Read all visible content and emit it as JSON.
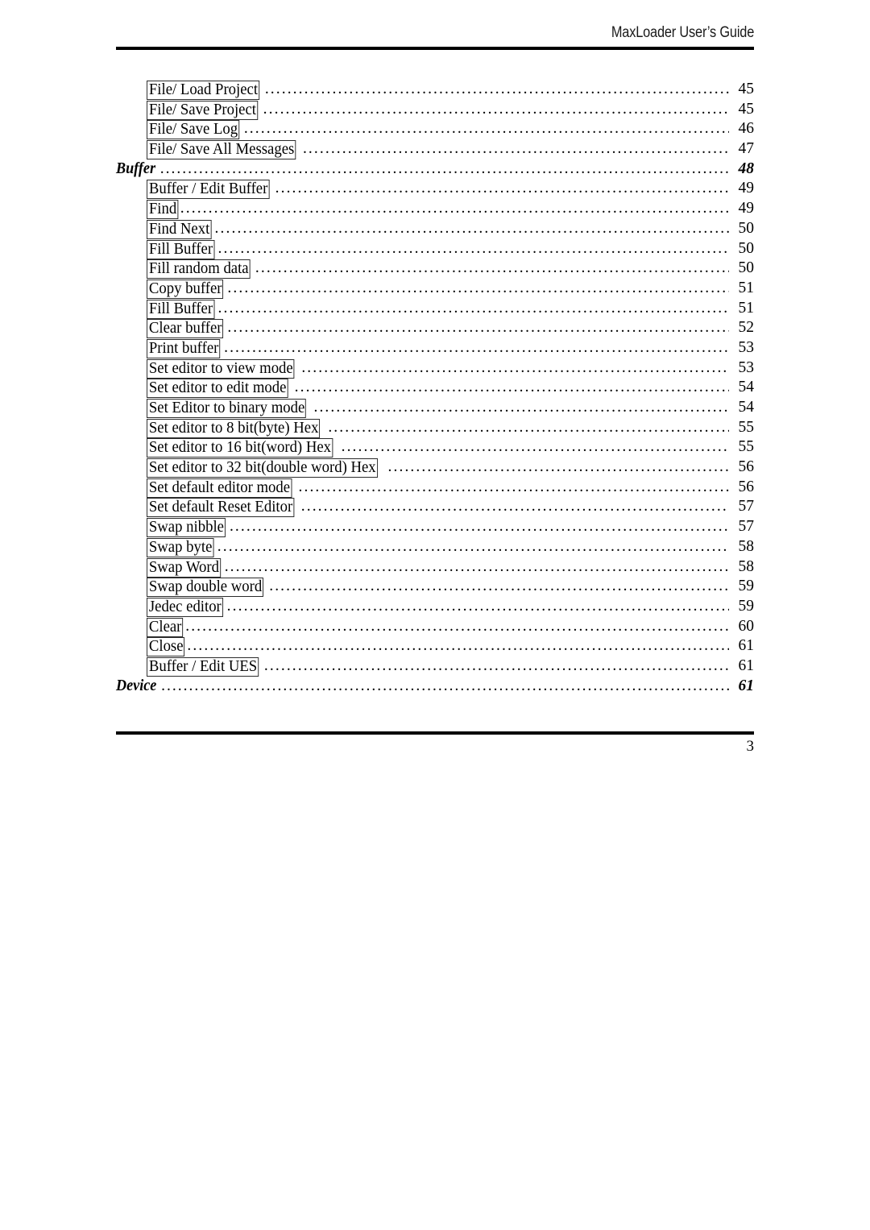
{
  "header": {
    "title": "MaxLoader User’s Guide"
  },
  "footer": {
    "page_number": "3"
  },
  "toc": {
    "entries": [
      {
        "label": "File/ Load Project",
        "page": "45",
        "level": 1
      },
      {
        "label": "File/ Save Project",
        "page": "45",
        "level": 1
      },
      {
        "label": "File/ Save Log",
        "page": "46",
        "level": 1
      },
      {
        "label": "File/ Save All Messages",
        "page": "47",
        "level": 1
      },
      {
        "label": "Buffer",
        "page": "48",
        "level": 0
      },
      {
        "label": "Buffer / Edit Buffer",
        "page": "49",
        "level": 1
      },
      {
        "label": "Find",
        "page": "49",
        "level": 1
      },
      {
        "label": "Find Next",
        "page": "50",
        "level": 1
      },
      {
        "label": "Fill Buffer",
        "page": "50",
        "level": 1
      },
      {
        "label": "Fill random data",
        "page": "50",
        "level": 1
      },
      {
        "label": "Copy buffer",
        "page": "51",
        "level": 1
      },
      {
        "label": "Fill Buffer",
        "page": "51",
        "level": 1
      },
      {
        "label": "Clear  buffer",
        "page": "52",
        "level": 1
      },
      {
        "label": "Print buffer",
        "page": "53",
        "level": 1
      },
      {
        "label": "Set editor to view mode",
        "page": "53",
        "level": 1
      },
      {
        "label": "Set editor to edit mode",
        "page": "54",
        "level": 1
      },
      {
        "label": "Set Editor to binary mode",
        "page": "54",
        "level": 1
      },
      {
        "label": "Set editor to 8 bit(byte) Hex",
        "page": "55",
        "level": 1
      },
      {
        "label": "Set editor to 16 bit(word) Hex",
        "page": "55",
        "level": 1
      },
      {
        "label": "Set editor to 32 bit(double word) Hex",
        "page": "56",
        "level": 1
      },
      {
        "label": "Set default editor mode",
        "page": "56",
        "level": 1
      },
      {
        "label": "Set default Reset Editor",
        "page": "57",
        "level": 1
      },
      {
        "label": "Swap nibble",
        "page": "57",
        "level": 1
      },
      {
        "label": "Swap byte",
        "page": "58",
        "level": 1
      },
      {
        "label": "Swap Word",
        "page": "58",
        "level": 1
      },
      {
        "label": "Swap double word",
        "page": "59",
        "level": 1
      },
      {
        "label": "Jedec editor",
        "page": "59",
        "level": 1
      },
      {
        "label": "Clear",
        "page": "60",
        "level": 1
      },
      {
        "label": "Close",
        "page": "61",
        "level": 1
      },
      {
        "label": "Buffer / Edit UES",
        "page": "61",
        "level": 1
      },
      {
        "label": "Device",
        "page": "61",
        "level": 0
      }
    ]
  }
}
